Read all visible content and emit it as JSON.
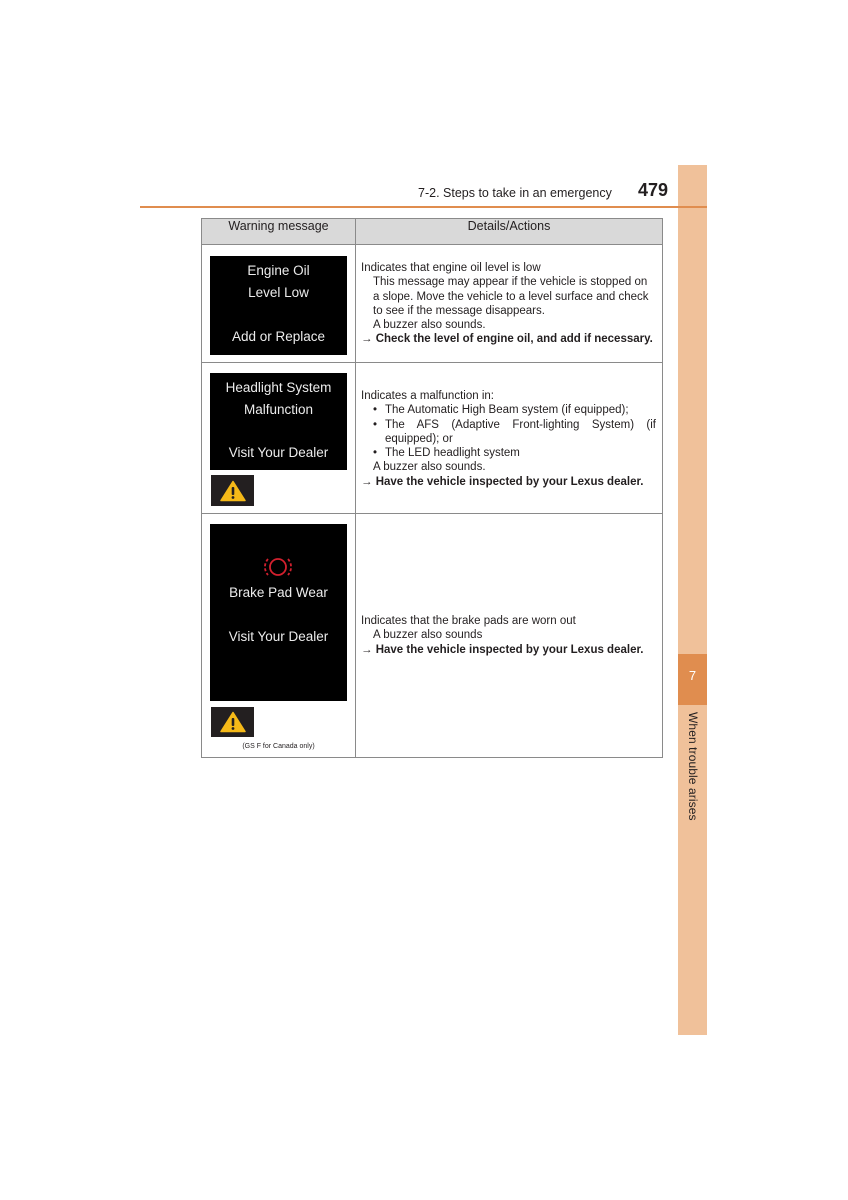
{
  "header": {
    "section_title": "7-2. Steps to take in an emergency",
    "page_number": "479"
  },
  "side_tab": {
    "chapter_number": "7",
    "chapter_title": "When trouble arises"
  },
  "table": {
    "columns": [
      "Warning message",
      "Details/Actions"
    ],
    "rows": [
      {
        "display_lines": [
          "Engine Oil",
          "Level Low",
          "Add or Replace"
        ],
        "has_warning_icon": false,
        "details": {
          "summary": "Indicates that engine oil level is low",
          "notes": [
            "This message may appear if the vehicle is stopped on a slope. Move the vehicle to a level surface and check to see if the message disappears.",
            "A buzzer also sounds."
          ],
          "action": "→ Check the level of engine oil, and add if necessary."
        }
      },
      {
        "display_lines": [
          "Headlight System",
          "Malfunction",
          "Visit Your Dealer"
        ],
        "has_warning_icon": true,
        "details": {
          "summary": "Indicates a malfunction in:",
          "bullets": [
            "The Automatic High Beam system (if equipped);",
            "The AFS (Adaptive Front-lighting System) (if equipped); or",
            "The LED headlight system"
          ],
          "notes": [
            "A buzzer also sounds."
          ],
          "action": "→ Have the vehicle inspected by your Lexus dealer."
        }
      },
      {
        "display_lines": [
          "Brake Pad Wear",
          "Visit Your Dealer"
        ],
        "display_icon": "brake-warning-icon",
        "has_warning_icon": true,
        "footnote": "(GS F for Canada only)",
        "details": {
          "summary": "Indicates that the brake pads are worn out",
          "notes": [
            "A buzzer also sounds"
          ],
          "action": "→ Have the vehicle inspected by your Lexus dealer."
        }
      }
    ]
  },
  "colors": {
    "accent": "#e08d4f",
    "side_tab": "#f0c19a",
    "header_bg": "#d9d9d9",
    "warning_yellow": "#f5b918",
    "brake_icon_red": "#d2202e"
  }
}
